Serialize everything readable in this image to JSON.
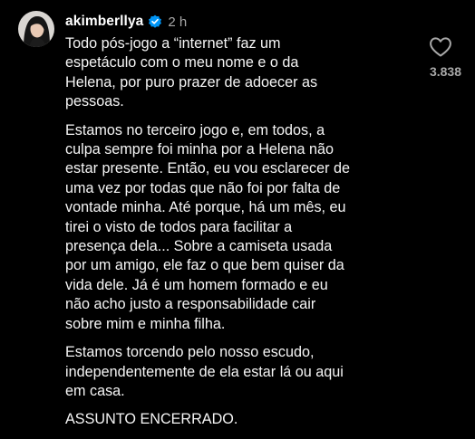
{
  "comment": {
    "username": "akimberllya",
    "verified": true,
    "time": "2 h",
    "paragraphs": [
      "Todo pós-jogo a “internet” faz um\nespetáculo com o meu nome e o da\nHelena, por puro prazer de adoecer as\npessoas.",
      "Estamos no terceiro jogo e, em todos, a\nculpa sempre foi minha por a Helena não\nestar presente. Então, eu vou esclarecer de\numa vez por todas que não foi por falta de\nvontade minha. Até porque, há um mês, eu\ntirei o visto de todos para facilitar a\npresença dela... Sobre a camiseta usada\npor um amigo, ele faz o que bem quiser da\nvida dele. Já é um homem formado e eu\nnão acho justo a responsabilidade cair\nsobre mim e minha filha.",
      "Estamos torcendo pelo nosso escudo,\nindependentemente de ela estar lá ou aqui\nem casa.",
      "ASSUNTO ENCERRADO."
    ],
    "like_count": "3.838",
    "like_icon": "heart-outline-icon",
    "verified_icon": "verified-badge-icon"
  },
  "colors": {
    "background": "#000000",
    "text": "#f5f5f5",
    "muted": "#a8a8a8",
    "verified_blue": "#0095f6"
  }
}
